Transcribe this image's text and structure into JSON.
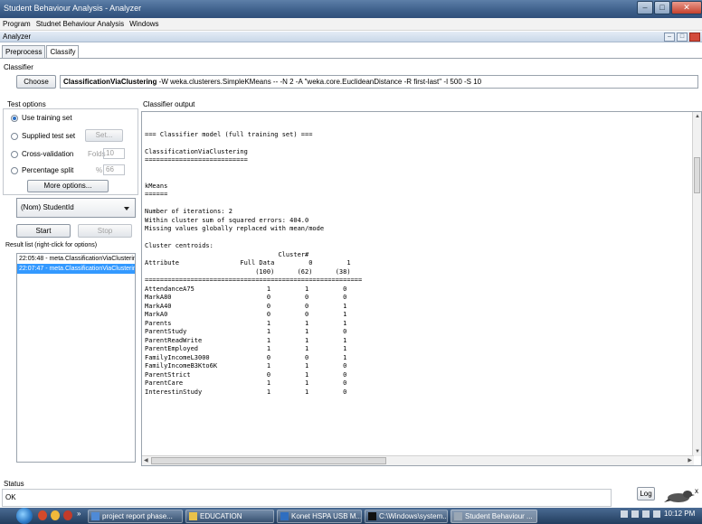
{
  "window": {
    "title": "Student Behaviour Analysis - Analyzer"
  },
  "menubar": {
    "items": [
      "Program",
      "Studnet Behaviour Analysis",
      "Windows"
    ]
  },
  "inner_frame": {
    "title": "Analyzer"
  },
  "tabs": [
    "Preprocess",
    "Classify"
  ],
  "classifier": {
    "section_label": "Classifier",
    "choose_label": "Choose",
    "name": "ClassificationViaClustering",
    "options": " -W weka.clusterers.SimpleKMeans -- -N 2 -A \"weka.core.EuclideanDistance -R first-last\" -I 500 -S 10"
  },
  "test_options": {
    "label": "Test options",
    "use_training_set": "Use training set",
    "supplied_test_set": "Supplied test set",
    "set_button": "Set...",
    "cross_validation": "Cross-validation",
    "folds_label": "Folds",
    "folds_value": "10",
    "percentage_split": "Percentage split",
    "percent_label": "%",
    "percent_value": "66",
    "more_options": "More options...",
    "selected": "use_training_set"
  },
  "class_attribute": "(Nom) StudentId",
  "run": {
    "start": "Start",
    "stop": "Stop"
  },
  "result_list": {
    "label": "Result list (right-click for options)",
    "items": [
      "22:05:48 - meta.ClassificationViaClustering",
      "22:07:47 - meta.ClassificationViaClustering"
    ],
    "selected_index": 1
  },
  "output": {
    "label": "Classifier output",
    "lines": [
      "",
      "=== Classifier model (full training set) ===",
      "",
      "ClassificationViaClustering",
      "===========================",
      "",
      "",
      "kMeans",
      "======",
      "",
      "Number of iterations: 2",
      "Within cluster sum of squared errors: 404.0",
      "Missing values globally replaced with mean/mode",
      "",
      "Cluster centroids:",
      "                                   Cluster#",
      "Attribute                Full Data         0         1",
      "                             (100)      (62)      (38)",
      "=========================================================",
      "AttendanceA75                   1         1         0",
      "MarkA80                         0         0         0",
      "MarkA40                         0         0         1",
      "MarkA0                          0         0         1",
      "Parents                         1         1         1",
      "ParentStudy                     1         1         0",
      "ParentReadWrite                 1         1         1",
      "ParentEmployed                  1         1         1",
      "FamilyIncomeL3000               0         0         1",
      "FamilyIncomeB3Kto6K             1         1         0",
      "ParentStrict                    0         1         0",
      "ParentCare                      1         1         0",
      "InterestinStudy                 1         1         0"
    ]
  },
  "status": {
    "label": "Status",
    "value": "OK",
    "log_button": "Log",
    "extra": "x"
  },
  "taskbar": {
    "buttons": [
      "project report phase...",
      "EDUCATION",
      "Konet HSPA USB M...",
      "C:\\Windows\\system...",
      "Student Behaviour ..."
    ],
    "more": "»",
    "clock": "10:12 PM"
  },
  "colors": {
    "selection": "#3399ff",
    "titlebar": "#3d5f8a",
    "taskbar": "#223d5e"
  }
}
